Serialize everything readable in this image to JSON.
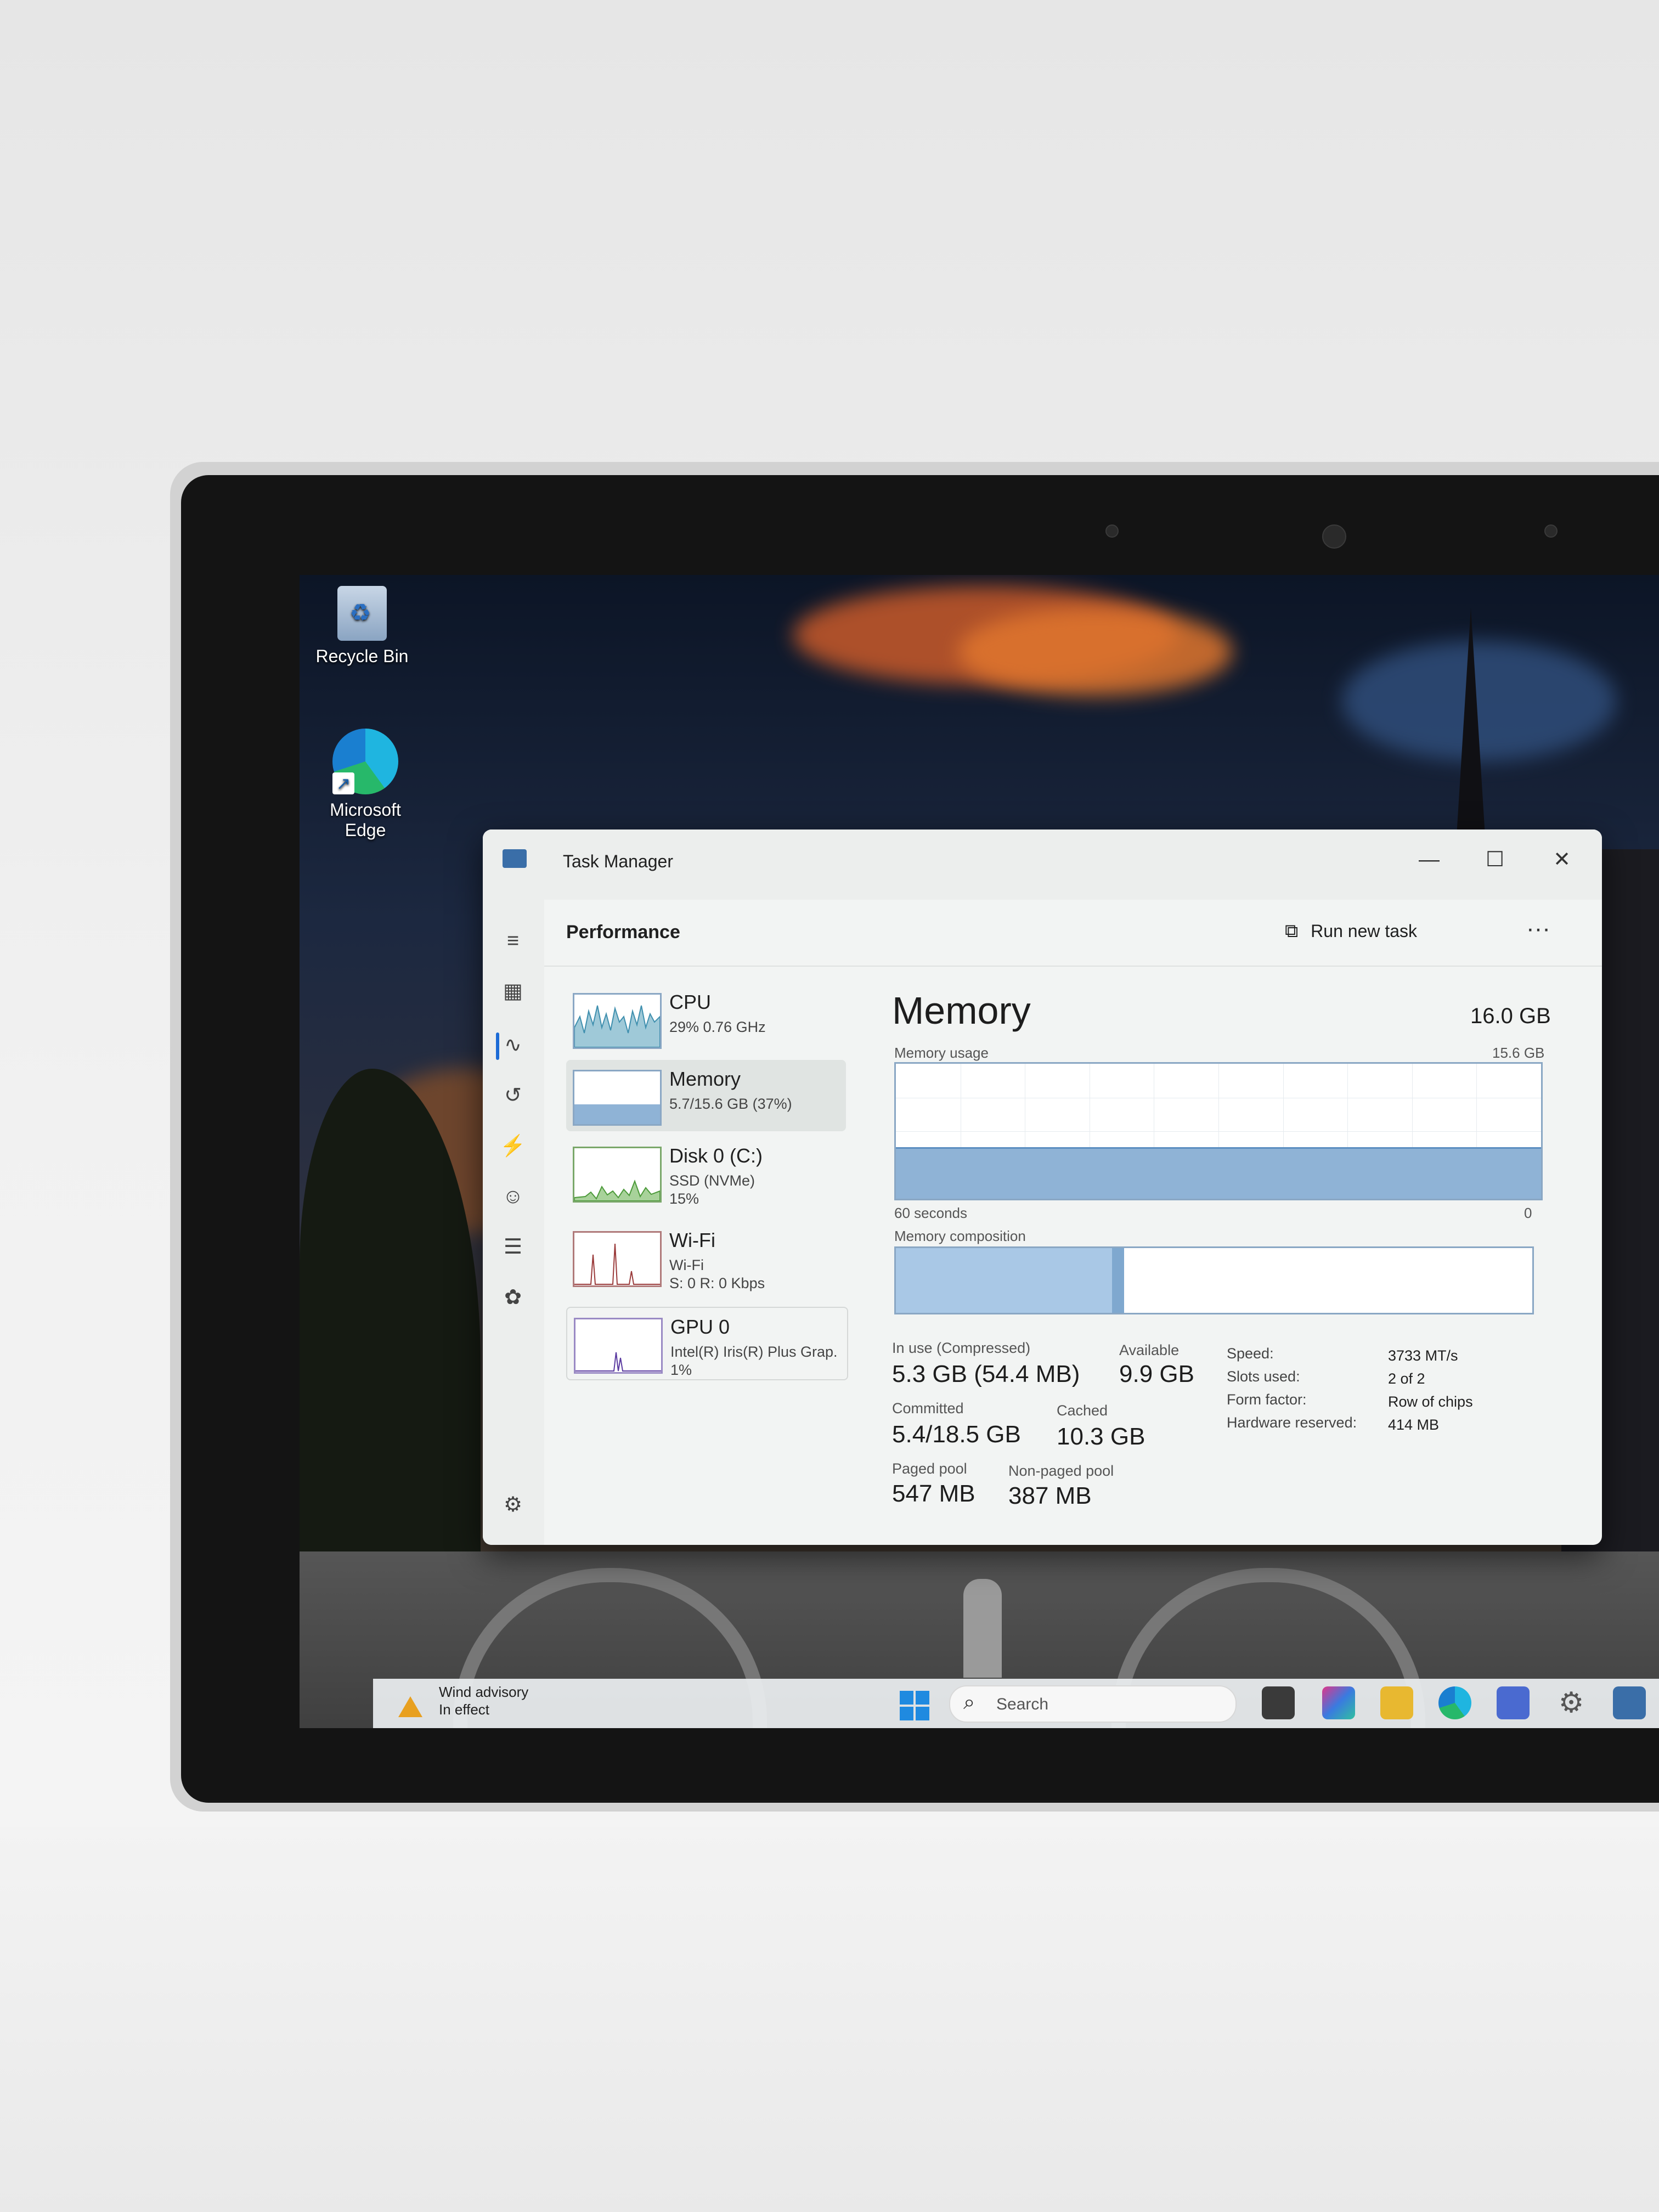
{
  "desktop": {
    "icons": [
      {
        "label": "Recycle Bin"
      },
      {
        "label": "Microsoft Edge"
      }
    ]
  },
  "window": {
    "title": "Task Manager",
    "controls": {
      "minimize": "—",
      "maximize": "☐",
      "close": "✕"
    }
  },
  "header": {
    "title": "Performance",
    "run_new_task": "Run new task",
    "more": "···"
  },
  "perf_list": [
    {
      "name": "CPU",
      "sub1": "29%  0.76 GHz",
      "sub2": "",
      "sub3": ""
    },
    {
      "name": "Memory",
      "sub1": "5.7/15.6 GB (37%)",
      "sub2": "",
      "sub3": ""
    },
    {
      "name": "Disk 0 (C:)",
      "sub1": "SSD (NVMe)",
      "sub2": "15%",
      "sub3": ""
    },
    {
      "name": "Wi-Fi",
      "sub1": "Wi-Fi",
      "sub2": "S: 0  R: 0 Kbps",
      "sub3": ""
    },
    {
      "name": "GPU 0",
      "sub1": "Intel(R) Iris(R) Plus Grap.",
      "sub2": "1%",
      "sub3": ""
    }
  ],
  "memory": {
    "title": "Memory",
    "total": "16.0 GB",
    "usage_label": "Memory usage",
    "usage_max": "15.6 GB",
    "time_label": "60 seconds",
    "zero_label": "0",
    "usage_fraction": 0.37,
    "composition_label": "Memory composition",
    "composition_in_use_fraction": 0.34,
    "in_use_label": "In use (Compressed)",
    "in_use_value": "5.3 GB (54.4 MB)",
    "available_label": "Available",
    "available_value": "9.9 GB",
    "committed_label": "Committed",
    "committed_value": "5.4/18.5 GB",
    "cached_label": "Cached",
    "cached_value": "10.3 GB",
    "paged_label": "Paged pool",
    "paged_value": "547 MB",
    "nonpaged_label": "Non-paged pool",
    "nonpaged_value": "387 MB",
    "details": [
      {
        "key": "Speed:",
        "value": "3733 MT/s"
      },
      {
        "key": "Slots used:",
        "value": "2 of 2"
      },
      {
        "key": "Form factor:",
        "value": "Row of chips"
      },
      {
        "key": "Hardware reserved:",
        "value": "414 MB"
      }
    ]
  },
  "taskbar": {
    "weather_line1": "Wind advisory",
    "weather_line2": "In effect",
    "search_placeholder": "Search"
  },
  "colors": {
    "graph_fill": "#8fb3d6",
    "graph_border": "#8aa7c4",
    "accent": "#1c6bd6"
  }
}
